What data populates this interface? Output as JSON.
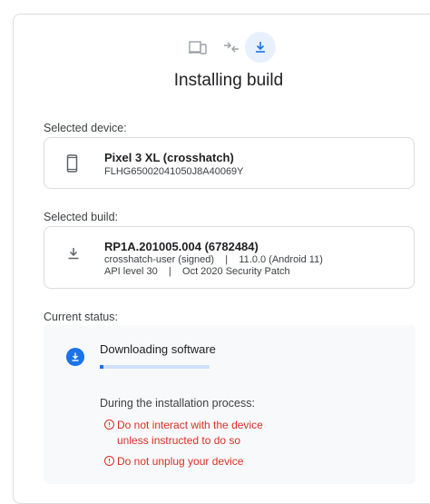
{
  "stepper": {
    "steps": [
      {
        "name": "Select device",
        "icon": "devices-icon",
        "state": "done"
      },
      {
        "name": "Select build",
        "icon": "transfer-icon",
        "state": "done"
      },
      {
        "name": "Install build",
        "icon": "download-icon",
        "state": "active"
      }
    ]
  },
  "title": "Installing build",
  "device": {
    "label": "Selected device:",
    "name": "Pixel 3 XL (crosshatch)",
    "serial": "FLHG65002041050J8A40069Y",
    "icon": "phone-icon"
  },
  "build": {
    "label": "Selected build:",
    "id": "RP1A.201005.004 (6782484)",
    "line1": "crosshatch-user (signed)    |    11.0.0 (Android 11)",
    "line2": "API level 30    |    Oct 2020 Security Patch",
    "icon": "download-icon"
  },
  "status": {
    "label": "Current status:",
    "title": "Downloading software",
    "progress": 0.03,
    "note_title": "During the installation process:",
    "warnings": [
      {
        "line1": "Do not interact with the device",
        "line2": "unless instructed to do so"
      },
      {
        "line1": "Do not unplug your device"
      }
    ]
  },
  "colors": {
    "accent": "#1a73e8",
    "warning": "#d93025",
    "panel": "#f8f9fa",
    "border": "#dadce0"
  }
}
